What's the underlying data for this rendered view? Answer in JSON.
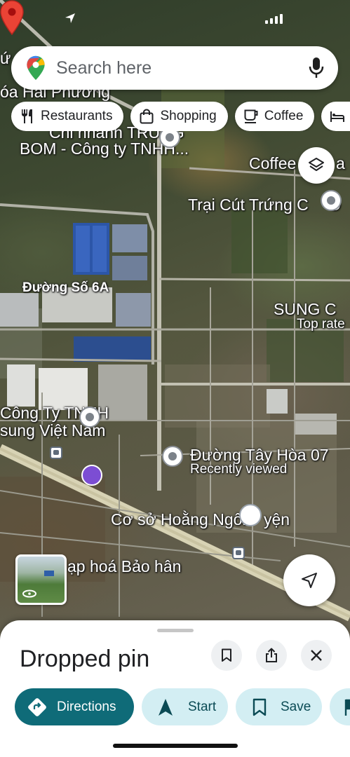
{
  "search": {
    "placeholder": "Search here"
  },
  "chips": [
    {
      "label": "Restaurants",
      "icon": "fork-knife-icon"
    },
    {
      "label": "Shopping",
      "icon": "shopping-bag-icon"
    },
    {
      "label": "Coffee",
      "icon": "coffee-cup-icon"
    },
    {
      "label": "",
      "icon": "hotel-bed-icon"
    }
  ],
  "map_labels": {
    "l1": "óa Hai Phương",
    "l2": "Chi nhánh TRUNG",
    "l3": "BOM - Công ty TNHH...",
    "l4": "Coffee",
    "l4b": "a",
    "l5": "Trại Cút Trứng C",
    "l5b": "O",
    "l6": "Đường Số 6A",
    "l7": "SUNG C",
    "l7b": "Top rate",
    "l8": "Công Ty TNHH",
    "l9": "sung Việt Nam",
    "l10": "Đường Tây Hòa 07",
    "l10b": "Recently viewed",
    "l11": "Cơ sở Hoằng Ngôn",
    "l11b": "yện",
    "l12": "ạp hoá Bảo hân",
    "l13": "ứ"
  },
  "sheet": {
    "title": "Dropped pin",
    "actions": [
      {
        "label": "Directions",
        "icon": "directions-diamond-icon"
      },
      {
        "label": "Start",
        "icon": "navigation-arrow-icon"
      },
      {
        "label": "Save",
        "icon": "bookmark-icon"
      },
      {
        "label": "",
        "icon": "flag-icon"
      }
    ]
  },
  "colors": {
    "primary_action": "#0f6b78",
    "secondary_action": "#d3eef3",
    "dropped_pin": "#ea4335"
  }
}
